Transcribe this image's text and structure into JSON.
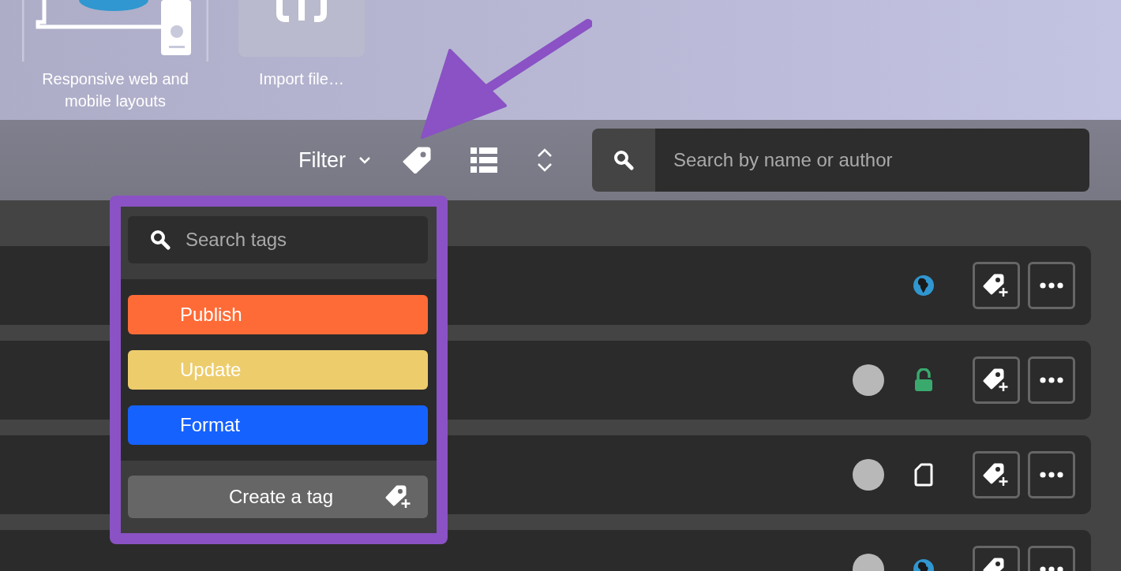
{
  "templates": [
    {
      "kind": "responsive",
      "label": "Responsive web and\nmobile layouts"
    },
    {
      "kind": "import",
      "label": "Import file…"
    }
  ],
  "toolbar": {
    "filter_label": "Filter",
    "search": {
      "placeholder": "Search by name or author"
    }
  },
  "rows": [
    {
      "avatar": false,
      "kind": "public"
    },
    {
      "avatar": true,
      "kind": "unlocked"
    },
    {
      "avatar": true,
      "kind": "draft"
    },
    {
      "avatar": true,
      "kind": "public"
    }
  ],
  "tag_menu": {
    "search": {
      "placeholder": "Search tags"
    },
    "tags": [
      {
        "label": "Publish",
        "color": "#ff6b37"
      },
      {
        "label": "Update",
        "color": "#edcc6c"
      },
      {
        "label": "Format",
        "color": "#1662ff"
      }
    ],
    "create_button": "Create a tag"
  }
}
